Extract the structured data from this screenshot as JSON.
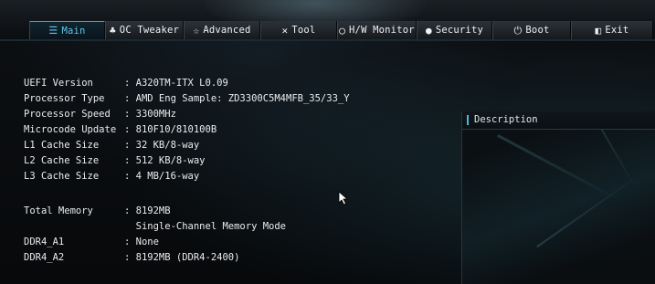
{
  "tabs": [
    {
      "label": "Main",
      "icon": "list-icon",
      "glyph": "☰",
      "active": true
    },
    {
      "label": "OC Tweaker",
      "icon": "rocket-icon",
      "glyph": "♣",
      "active": false
    },
    {
      "label": "Advanced",
      "icon": "star-icon",
      "glyph": "☆",
      "active": false
    },
    {
      "label": "Tool",
      "icon": "tools-icon",
      "glyph": "✕",
      "active": false
    },
    {
      "label": "H/W Monitor",
      "icon": "monitor-icon",
      "glyph": "◯",
      "active": false
    },
    {
      "label": "Security",
      "icon": "shield-icon",
      "glyph": "●",
      "active": false
    },
    {
      "label": "Boot",
      "icon": "power-icon",
      "glyph": "⏻",
      "active": false
    },
    {
      "label": "Exit",
      "icon": "exit-icon",
      "glyph": "◧",
      "active": false
    }
  ],
  "info": [
    {
      "key": "UEFI Version",
      "value": ": A320TM-ITX L0.09"
    },
    {
      "key": "Processor Type",
      "value": ": AMD Eng Sample: ZD3300C5M4MFB_35/33_Y"
    },
    {
      "key": "Processor Speed",
      "value": ": 3300MHz"
    },
    {
      "key": "Microcode Update",
      "value": ": 810F10/810100B"
    },
    {
      "key": "L1 Cache Size",
      "value": ": 32 KB/8-way"
    },
    {
      "key": "L2 Cache Size",
      "value": ": 512 KB/8-way"
    },
    {
      "key": "L3 Cache Size",
      "value": ": 4 MB/16-way"
    },
    {
      "key": "Total Memory",
      "value": ": 8192MB"
    },
    {
      "key": "",
      "value": "  Single-Channel Memory Mode"
    },
    {
      "key": "DDR4_A1",
      "value": ": None"
    },
    {
      "key": "DDR4_A2",
      "value": ": 8192MB (DDR4-2400)"
    }
  ],
  "description": {
    "title": "Description"
  },
  "colors": {
    "accent": "#4bb8dc",
    "background": "#0b0d10",
    "text": "#e6eaee"
  }
}
